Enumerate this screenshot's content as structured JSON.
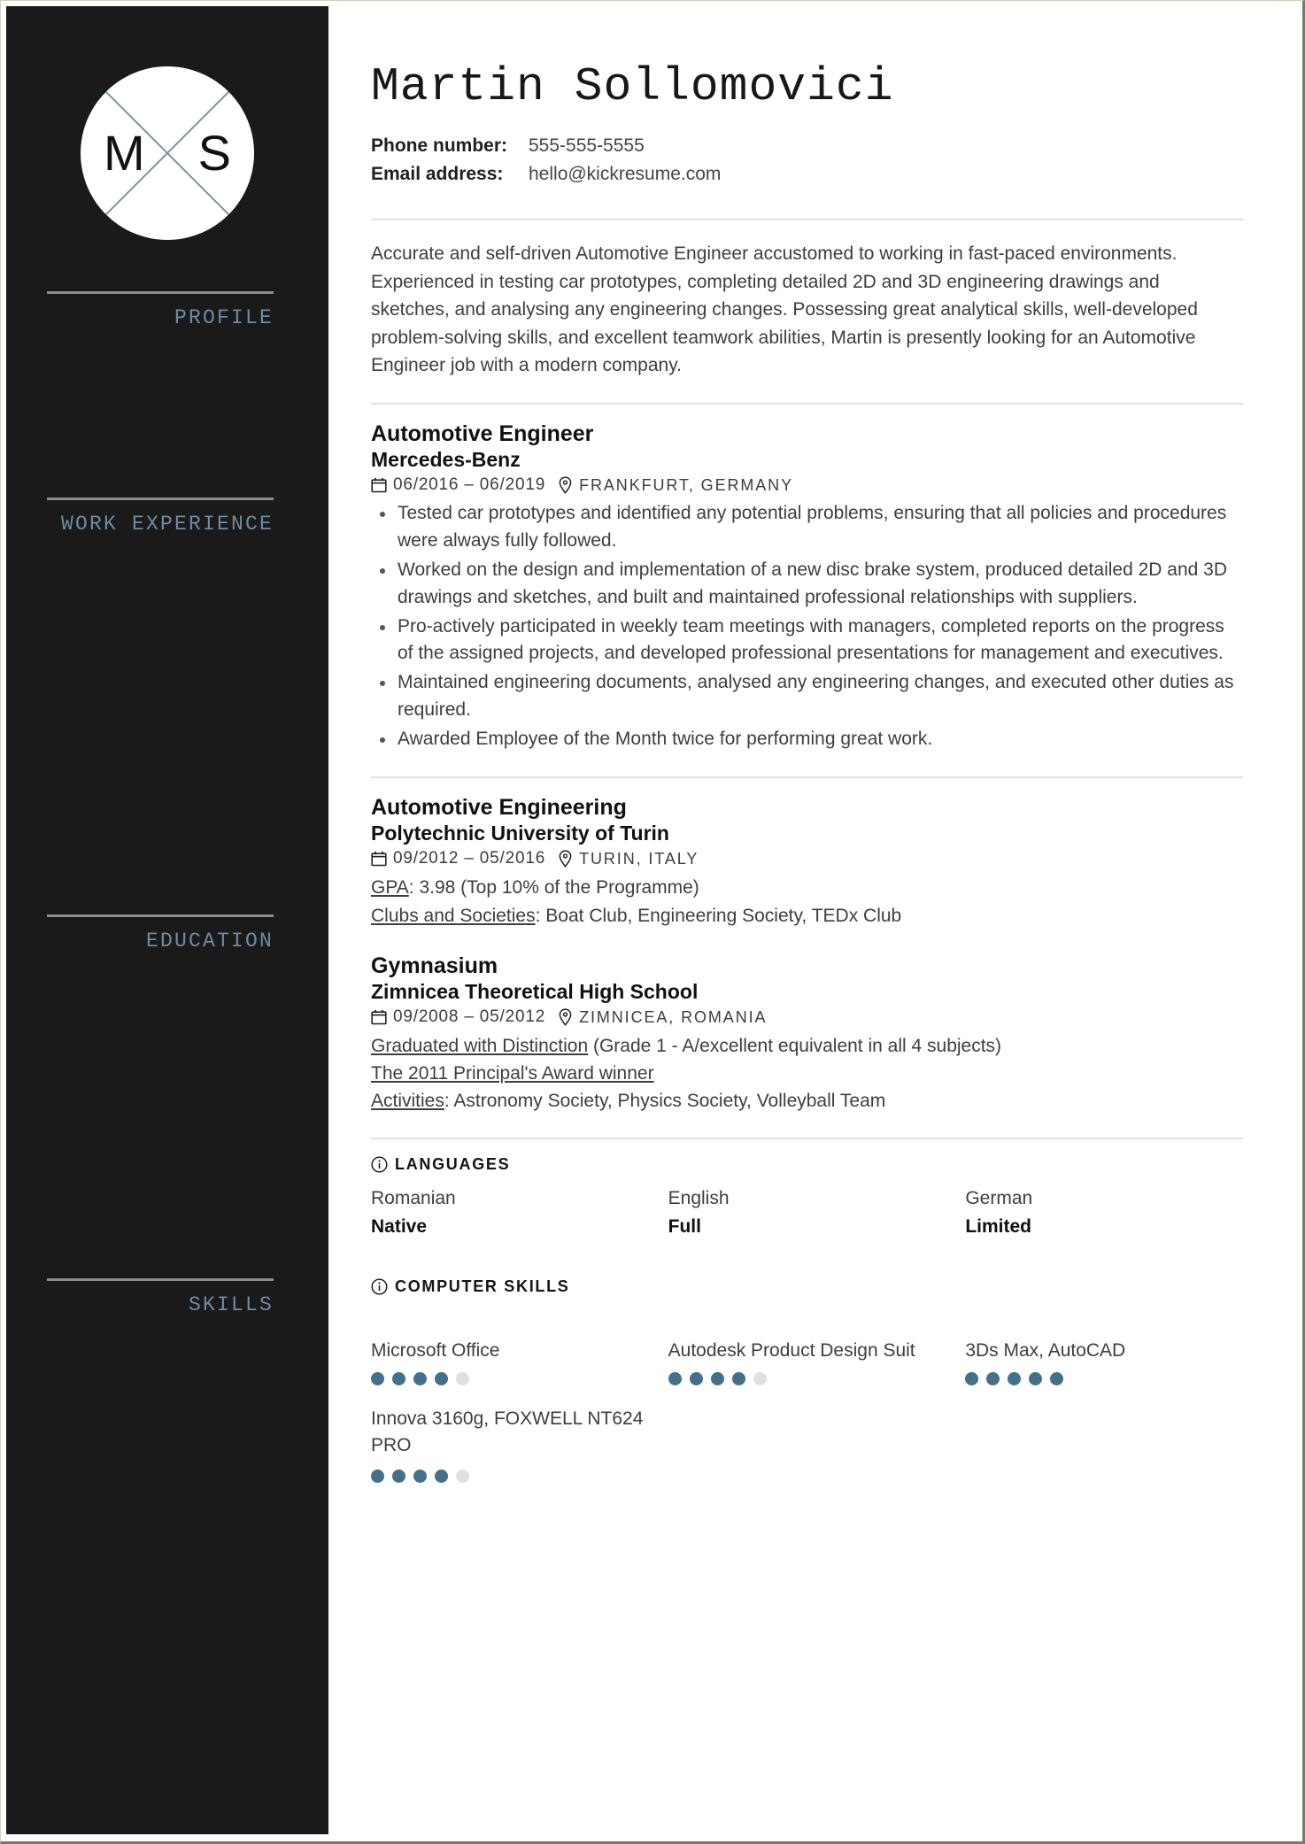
{
  "sidebar": {
    "monogram": {
      "left_letter": "M",
      "right_letter": "S"
    },
    "sections": [
      {
        "label": "PROFILE"
      },
      {
        "label": "WORK EXPERIENCE"
      },
      {
        "label": "EDUCATION"
      },
      {
        "label": "SKILLS"
      }
    ]
  },
  "header": {
    "name": "Martin Sollomovici",
    "phone_label": "Phone number:",
    "phone_value": "555-555-5555",
    "email_label": "Email address:",
    "email_value": "hello@kickresume.com"
  },
  "profile": {
    "text": "Accurate and self-driven Automotive Engineer accustomed to working in fast-paced environments. Experienced in testing car prototypes, completing detailed 2D and 3D engineering drawings and sketches, and analysing any engineering changes. Possessing great analytical skills, well-developed problem-solving skills, and excellent teamwork abilities, Martin is presently looking for an Automotive Engineer job with a modern company."
  },
  "work_experience": [
    {
      "title": "Automotive Engineer",
      "company": "Mercedes-Benz",
      "date": "06/2016 – 06/2019",
      "location": "FRANKFURT, GERMANY",
      "bullets": [
        "Tested car prototypes and identified any potential problems, ensuring that all policies and procedures were always fully followed.",
        "Worked on the design and implementation of a new disc brake system, produced detailed 2D and 3D drawings and sketches, and built and maintained professional relationships with suppliers.",
        "Pro-actively participated in weekly team meetings with managers, completed reports on the progress of the assigned projects, and developed professional presentations for management and executives.",
        "Maintained engineering documents, analysed any engineering changes, and executed other duties as required.",
        "Awarded Employee of the Month twice for performing great work."
      ]
    }
  ],
  "education": [
    {
      "title": "Automotive Engineering",
      "school": "Polytechnic University of Turin",
      "date": "09/2012 – 05/2016",
      "location": "TURIN, ITALY",
      "details": [
        {
          "label": "GPA",
          "underline": true,
          "sep": ": ",
          "text": "3.98 (Top 10% of the Programme)"
        },
        {
          "label": "Clubs and Societies",
          "underline": true,
          "sep": ": ",
          "text": "Boat Club, Engineering Society, TEDx Club"
        }
      ]
    },
    {
      "title": "Gymnasium",
      "school": "Zimnicea Theoretical High School",
      "date": "09/2008 – 05/2012",
      "location": "ZIMNICEA, ROMANIA",
      "details": [
        {
          "label": "Graduated with Distinction",
          "underline": true,
          "sep": " ",
          "text": "(Grade 1 - A/excellent equivalent in all 4 subjects)"
        },
        {
          "label": "The 2011 Principal's Award winner",
          "underline": true,
          "sep": "",
          "text": ""
        },
        {
          "label": "Activities",
          "underline": true,
          "sep": ": ",
          "text": "Astronomy Society, Physics Society, Volleyball Team"
        }
      ]
    }
  ],
  "languages": {
    "heading": "LANGUAGES",
    "items": [
      {
        "name": "Romanian",
        "level": "Native"
      },
      {
        "name": "English",
        "level": "Full"
      },
      {
        "name": "German",
        "level": "Limited"
      }
    ]
  },
  "computer_skills": {
    "heading": "COMPUTER SKILLS",
    "max_dots": 5,
    "items": [
      {
        "name": "Microsoft Office",
        "rating": 4
      },
      {
        "name": "Autodesk Product Design Suit",
        "rating": 4
      },
      {
        "name": "3Ds Max, AutoCAD",
        "rating": 5
      },
      {
        "name": "Innova 3160g, FOXWELL NT624 PRO",
        "rating": 4
      }
    ]
  },
  "colors": {
    "sidebar_bg": "#1a1a1a",
    "sidebar_label": "#6f8ba0",
    "dot_on": "#44708a",
    "dot_off": "#e0e0e0"
  }
}
